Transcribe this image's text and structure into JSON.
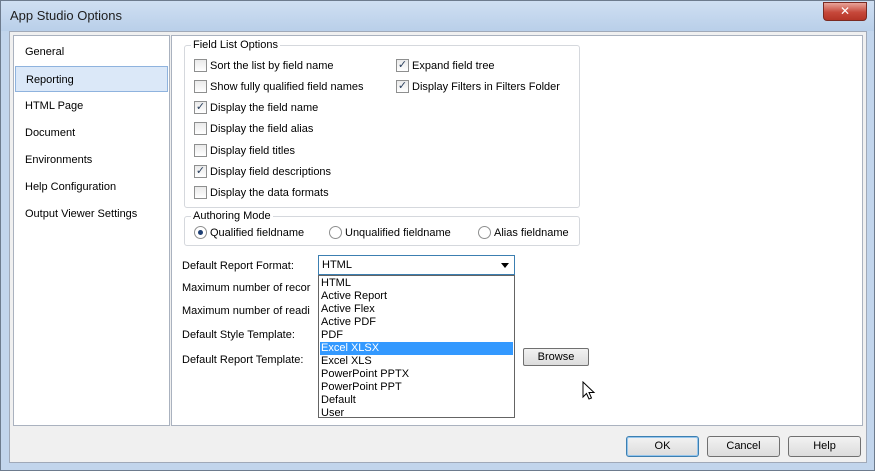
{
  "window": {
    "title": "App Studio Options",
    "close_label": "✕"
  },
  "nav": {
    "items": [
      {
        "label": "General",
        "selected": false
      },
      {
        "label": "Reporting",
        "selected": true
      },
      {
        "label": "HTML Page",
        "selected": false
      },
      {
        "label": "Document",
        "selected": false
      },
      {
        "label": "Environments",
        "selected": false
      },
      {
        "label": "Help Configuration",
        "selected": false
      },
      {
        "label": "Output Viewer Settings",
        "selected": false
      }
    ]
  },
  "field_list": {
    "title": "Field List Options",
    "options": [
      {
        "label": "Sort the list by field name",
        "checked": false
      },
      {
        "label": "Show fully qualified field names",
        "checked": false
      },
      {
        "label": "Display the field name",
        "checked": true
      },
      {
        "label": "Display the field alias",
        "checked": false
      },
      {
        "label": "Display field titles",
        "checked": false
      },
      {
        "label": "Display field descriptions",
        "checked": true
      },
      {
        "label": "Display the data formats",
        "checked": false
      },
      {
        "label": "Expand field tree",
        "checked": true
      },
      {
        "label": "Display Filters in Filters Folder",
        "checked": true
      }
    ],
    "check_glyph": "✓"
  },
  "authoring": {
    "title": "Authoring Mode",
    "options": [
      {
        "label": "Qualified fieldname",
        "selected": true
      },
      {
        "label": "Unqualified fieldname",
        "selected": false
      },
      {
        "label": "Alias fieldname",
        "selected": false
      }
    ]
  },
  "form": {
    "default_format_label": "Default Report Format:",
    "max_records_label": "Maximum number of recor",
    "max_readings_label": "Maximum number of readi",
    "style_template_label": "Default Style Template:",
    "report_template_label": "Default Report Template:",
    "format_value": "HTML",
    "browse_label": "Browse"
  },
  "dropdown": {
    "options": [
      "HTML",
      "Active Report",
      "Active Flex",
      "Active PDF",
      "PDF",
      "Excel XLSX",
      "Excel XLS",
      "PowerPoint PPTX",
      "PowerPoint PPT",
      "Default",
      "User"
    ],
    "highlighted_index": 5
  },
  "buttons": {
    "ok": "OK",
    "cancel": "Cancel",
    "help": "Help"
  },
  "colors": {
    "accent": "#3399ff",
    "selection": "#dbe8f8",
    "frame": "#c2d5ec"
  }
}
